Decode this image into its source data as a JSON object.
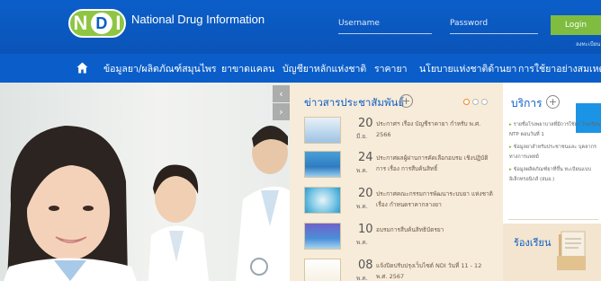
{
  "header": {
    "logo_text": "NDI",
    "brand_name": "National Drug Information",
    "username_placeholder": "Username",
    "password_placeholder": "Password",
    "login_label": "Login",
    "signup_label": "ลงทะเบียน"
  },
  "nav": {
    "items": [
      "ข้อมูลยา/ผลิตภัณฑ์สมุนไพร",
      "ยาขาดแคลน",
      "บัญชียาหลักแห่งชาติ",
      "ราคายา",
      "นโยบายแห่งชาติด้านยา",
      "การใช้ยาอย่างสมเหตุผล"
    ]
  },
  "hero": {
    "prev_label": "‹",
    "next_label": "›"
  },
  "news": {
    "title": "ข่าวสารประชาสัมพันธ์",
    "more_label": "+",
    "items": [
      {
        "day": "20",
        "month": "มี.ย.",
        "text": "ประกาศฯ เรื่อง บัญชีราคายา กำหรับ พ.ศ. 2566"
      },
      {
        "day": "24",
        "month": "พ.ค.",
        "text": "ประกาศผลผู้ผ่านการคัดเลือกอบรม เชิงปฏิบัติการ เรื่อง การสืบค้นสิทธิ์"
      },
      {
        "day": "20",
        "month": "พ.ค.",
        "text": "ประกาศคณะกรรมการพัฒนาระบบยา แห่งชาติ เรื่อง กำหนดราคากลางยา"
      },
      {
        "day": "10",
        "month": "พ.ค.",
        "text": "อบรมการสืบค้นสิทธิบัตรยา"
      },
      {
        "day": "08",
        "month": "พ.ค.",
        "text": "แจ้งปิดปรับปรุงเว็บไซต์ NDI วันที่ 11 - 12 พ.ศ. 2567"
      }
    ]
  },
  "services": {
    "title": "บริการ",
    "more_label": "+",
    "items": [
      "รายชื่อโรงพยาบาลที่มีการใช้ยา โรงเรียน NTP ตอนวันที่ 1",
      "ข้อมูลยาสำหรับประชาชนและ บุคลากรทางการแพทย์",
      "ข้อมูลผลิตภัณฑ์ยาที่ขึ้น ทะเบียนแบบอิเล็กทรอนิกส์ (สมอ.)"
    ],
    "complaint_title": "ร้องเรียน"
  },
  "colors": {
    "brand_blue": "#0b5ec9",
    "accent_green": "#7fbc3f",
    "news_bg": "#f7ebd9"
  }
}
